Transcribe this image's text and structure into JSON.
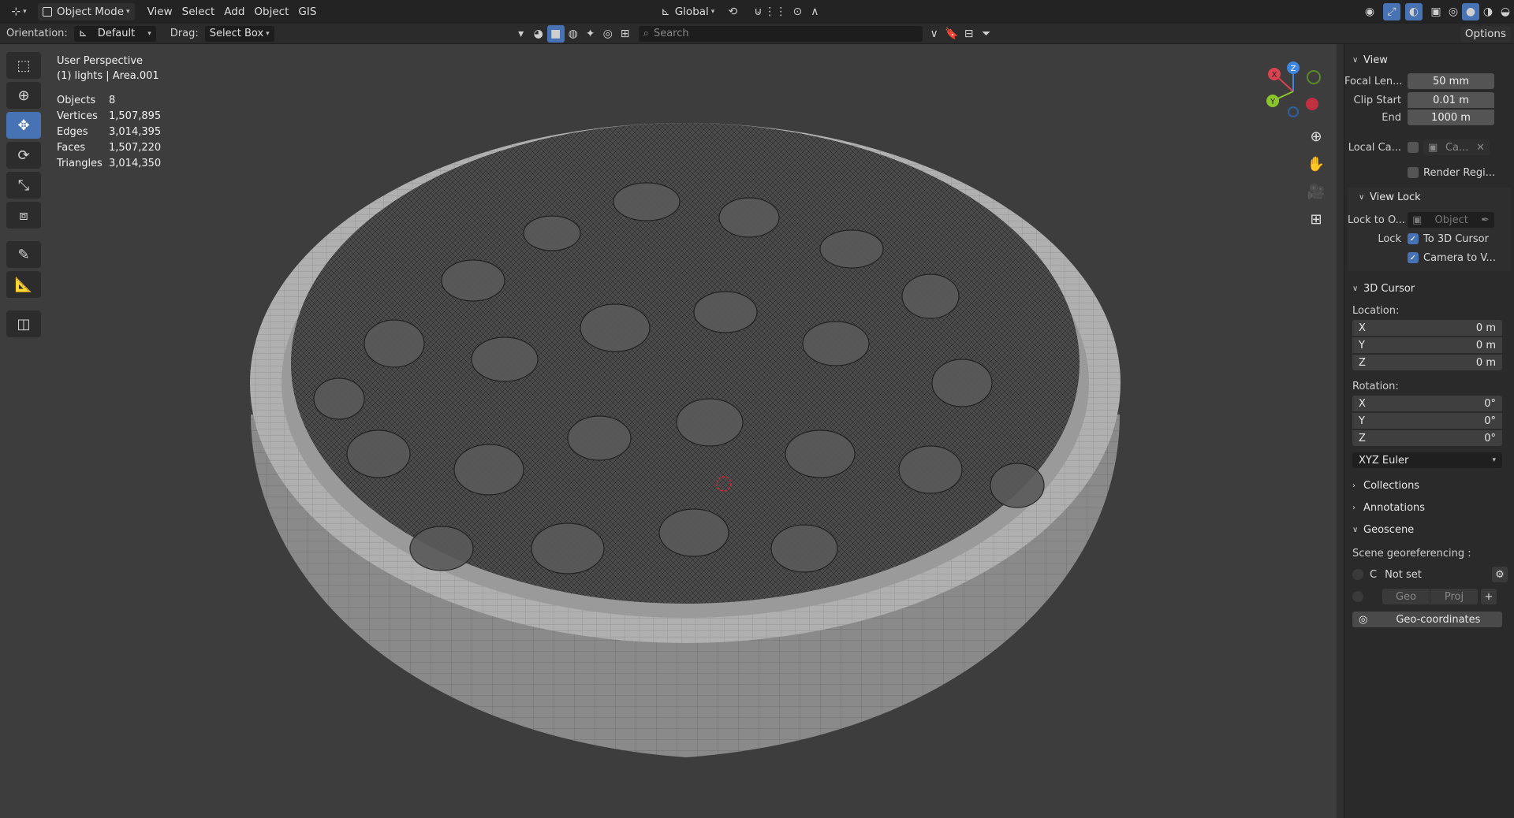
{
  "header": {
    "mode": "Object Mode",
    "menus": [
      "View",
      "Select",
      "Add",
      "Object",
      "GIS"
    ],
    "transform_orientation": "Global",
    "options_label": "Options"
  },
  "toolsettings": {
    "orientation_label": "Orientation:",
    "orientation_value": "Default",
    "drag_label": "Drag:",
    "drag_value": "Select Box",
    "search_placeholder": "Search"
  },
  "overlay": {
    "view_name": "User Perspective",
    "collection": "(1) lights | Area.001",
    "stats": [
      {
        "label": "Objects",
        "value": "8"
      },
      {
        "label": "Vertices",
        "value": "1,507,895"
      },
      {
        "label": "Edges",
        "value": "3,014,395"
      },
      {
        "label": "Faces",
        "value": "1,507,220"
      },
      {
        "label": "Triangles",
        "value": "3,014,350"
      }
    ]
  },
  "gizmo": {
    "x": "X",
    "y": "Y",
    "z": "Z"
  },
  "sidebar": {
    "view": {
      "title": "View",
      "focal_length_label": "Focal Len...",
      "focal_length": "50 mm",
      "clip_start_label": "Clip Start",
      "clip_start": "0.01 m",
      "end_label": "End",
      "end": "1000 m",
      "local_camera_label": "Local Ca...",
      "local_camera_value": "Ca...",
      "render_region_label": "Render Regi..."
    },
    "view_lock": {
      "title": "View Lock",
      "lock_to_label": "Lock to O...",
      "lock_to_placeholder": "Object",
      "lock_label": "Lock",
      "to_3d_cursor": "To 3D Cursor",
      "camera_to_view": "Camera to V..."
    },
    "cursor": {
      "title": "3D Cursor",
      "location_label": "Location:",
      "location": [
        {
          "axis": "X",
          "value": "0 m"
        },
        {
          "axis": "Y",
          "value": "0 m"
        },
        {
          "axis": "Z",
          "value": "0 m"
        }
      ],
      "rotation_label": "Rotation:",
      "rotation": [
        {
          "axis": "X",
          "value": "0°"
        },
        {
          "axis": "Y",
          "value": "0°"
        },
        {
          "axis": "Z",
          "value": "0°"
        }
      ],
      "rotation_mode": "XYZ Euler"
    },
    "collections": "Collections",
    "annotations": "Annotations",
    "geoscene": {
      "title": "Geoscene",
      "georef_label": "Scene georeferencing :",
      "crs_letter": "C",
      "crs_value": "Not set",
      "geo_btn": "Geo",
      "proj_btn": "Proj",
      "geo_coords_btn": "Geo-coordinates"
    }
  },
  "colors": {
    "accent": "#4772b3",
    "x_axis": "#d9424f",
    "y_axis": "#8bc42b",
    "z_axis": "#3f86e0"
  }
}
